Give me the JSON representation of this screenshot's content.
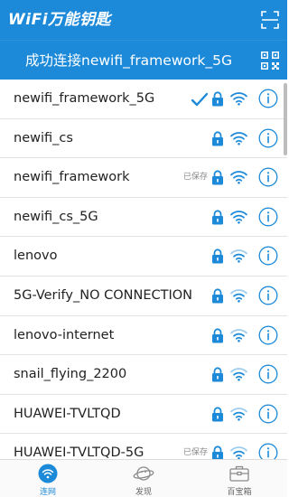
{
  "app": {
    "title": "WiFi万能钥匙"
  },
  "status": {
    "text": "成功连接newifi_framework_5G"
  },
  "networks": [
    {
      "name": "newifi_framework_5G",
      "saved": "",
      "connected": true,
      "locked": true,
      "signal": 3
    },
    {
      "name": "newifi_cs",
      "saved": "",
      "connected": false,
      "locked": true,
      "signal": 3
    },
    {
      "name": "newifi_framework",
      "saved": "已保存",
      "connected": false,
      "locked": true,
      "signal": 3
    },
    {
      "name": "newifi_cs_5G",
      "saved": "",
      "connected": false,
      "locked": true,
      "signal": 3
    },
    {
      "name": "lenovo",
      "saved": "",
      "connected": false,
      "locked": true,
      "signal": 2
    },
    {
      "name": "5G-Verify_NO CONNECTION",
      "saved": "",
      "connected": false,
      "locked": true,
      "signal": 2
    },
    {
      "name": "lenovo-internet",
      "saved": "",
      "connected": false,
      "locked": true,
      "signal": 2
    },
    {
      "name": "snail_flying_2200",
      "saved": "",
      "connected": false,
      "locked": true,
      "signal": 2
    },
    {
      "name": "HUAWEI-TVLTQD",
      "saved": "",
      "connected": false,
      "locked": true,
      "signal": 2
    },
    {
      "name": "HUAWEI-TVLTQD-5G",
      "saved": "已保存",
      "connected": false,
      "locked": true,
      "signal": 2
    }
  ],
  "nav": {
    "items": [
      {
        "label": "连网",
        "icon": "wifi-icon",
        "active": true
      },
      {
        "label": "发现",
        "icon": "planet-icon",
        "active": false
      },
      {
        "label": "百宝箱",
        "icon": "toolbox-icon",
        "active": false
      }
    ]
  },
  "colors": {
    "accent": "#1d8ad9",
    "bar": "#1d8ad9"
  }
}
